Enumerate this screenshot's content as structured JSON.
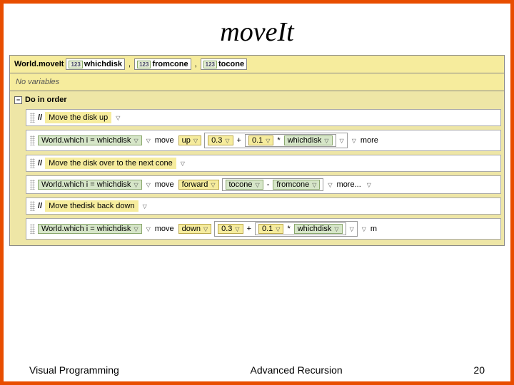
{
  "slide": {
    "title": "moveIt",
    "footer_left": "Visual Programming",
    "footer_center": "Advanced Recursion",
    "footer_right": "20"
  },
  "method": {
    "owner": "World.moveIt",
    "params": [
      {
        "icon": "123",
        "name": "whichdisk"
      },
      {
        "icon": "123",
        "name": "fromcone"
      },
      {
        "icon": "123",
        "name": "tocone"
      }
    ],
    "comma": ","
  },
  "no_variables": "No variables",
  "do_in_order": {
    "label": "Do in order",
    "collapse": "−"
  },
  "comments": {
    "slash": "//",
    "c1": "Move the disk up",
    "c2": "Move the disk over to the next cone",
    "c3": "Move thedisk back down"
  },
  "tiles": {
    "subject": "World.which i = whichdisk",
    "move": "move",
    "up": "up",
    "forward": "forward",
    "down": "down",
    "num03": "0.3",
    "num01": "0.1",
    "plus": "+",
    "minus": "-",
    "star": "*",
    "whichdisk": "whichdisk",
    "tocone": "tocone",
    "fromcone": "fromcone",
    "more": "more...",
    "more2": "more",
    "m": "m"
  }
}
